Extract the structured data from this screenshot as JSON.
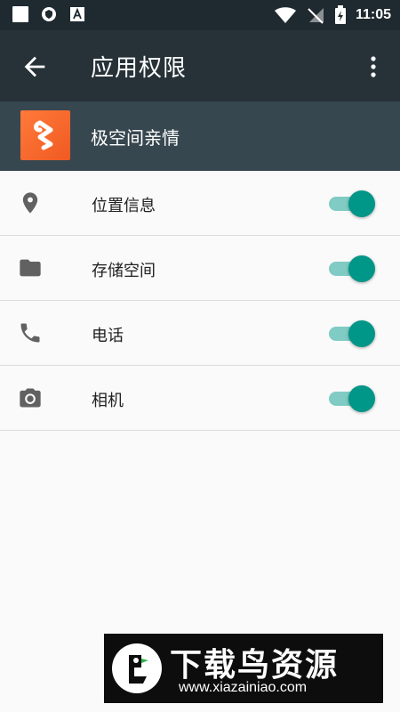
{
  "status_bar": {
    "time": "11:05"
  },
  "toolbar": {
    "title": "应用权限"
  },
  "app": {
    "name": "极空间亲情"
  },
  "permissions": [
    {
      "label": "位置信息",
      "icon": "location-pin-icon",
      "enabled": true
    },
    {
      "label": "存储空间",
      "icon": "folder-icon",
      "enabled": true
    },
    {
      "label": "电话",
      "icon": "phone-icon",
      "enabled": true
    },
    {
      "label": "相机",
      "icon": "camera-icon",
      "enabled": true
    }
  ],
  "watermark": {
    "title": "下载鸟资源",
    "url": "www.xiazainiao.com"
  },
  "colors": {
    "status_bar": "#1f2a30",
    "toolbar": "#263238",
    "app_header": "#37474f",
    "toggle_thumb": "#009688",
    "toggle_track": "#80cbc4",
    "app_icon": "#f26a2a"
  }
}
